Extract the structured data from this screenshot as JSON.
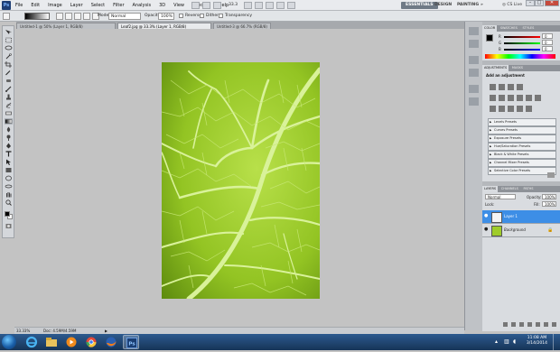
{
  "menubar": {
    "logo": "Ps",
    "items": [
      "File",
      "Edit",
      "Image",
      "Layer",
      "Select",
      "Filter",
      "Analysis",
      "3D",
      "View",
      "Window",
      "Help"
    ],
    "zoom": "33.3",
    "workspaces": [
      "ESSENTIALS",
      "DESIGN",
      "PAINTING"
    ],
    "more": "»",
    "cslive": "CS Live"
  },
  "options": {
    "mode_label": "Mode:",
    "mode_value": "Normal",
    "opacity_label": "Opacity:",
    "opacity_value": "100%",
    "reverse_label": "Reverse",
    "dither_label": "Dither",
    "transparency_label": "Transparency"
  },
  "tabs": [
    {
      "label": "Untitled-1 @ 50% (Layer 1, RGB/8)",
      "active": false
    },
    {
      "label": "Leaf2.jpg @ 33.3% (Layer 1, RGB/8)",
      "active": true
    },
    {
      "label": "Untitled-3 @ 66.7% (RGB/8)",
      "active": false
    }
  ],
  "status": {
    "zoom": "33.33%",
    "doc": "Doc: 4.59M/4.59M"
  },
  "panels": {
    "color_tabs": [
      "COLOR",
      "SWATCHES",
      "STYLES"
    ],
    "color_channels": [
      {
        "label": "R",
        "value": "0"
      },
      {
        "label": "G",
        "value": "0"
      },
      {
        "label": "B",
        "value": "0"
      }
    ],
    "adjust_tabs": [
      "ADJUSTMENTS",
      "MASKS"
    ],
    "adjust_title": "Add an adjustment",
    "presets": [
      "Levels Presets",
      "Curves Presets",
      "Exposure Presets",
      "Hue/Saturation Presets",
      "Black & White Presets",
      "Channel Mixer Presets",
      "Selective Color Presets"
    ],
    "layers_tabs": [
      "LAYERS",
      "CHANNELS",
      "PATHS"
    ],
    "blend_mode": "Normal",
    "opacity_label": "Opacity:",
    "opacity_value": "100%",
    "lock_label": "Lock:",
    "fill_label": "Fill:",
    "fill_value": "100%",
    "layers": [
      {
        "name": "Layer 1",
        "selected": true
      },
      {
        "name": "Background",
        "selected": false
      }
    ]
  },
  "taskbar": {
    "time": "11:08 AM",
    "date": "3/14/2014"
  },
  "colors": {
    "accent": "#3d8ee6",
    "leaf": "#9fcc2a",
    "canvas_bg": "#c3c3c3"
  }
}
